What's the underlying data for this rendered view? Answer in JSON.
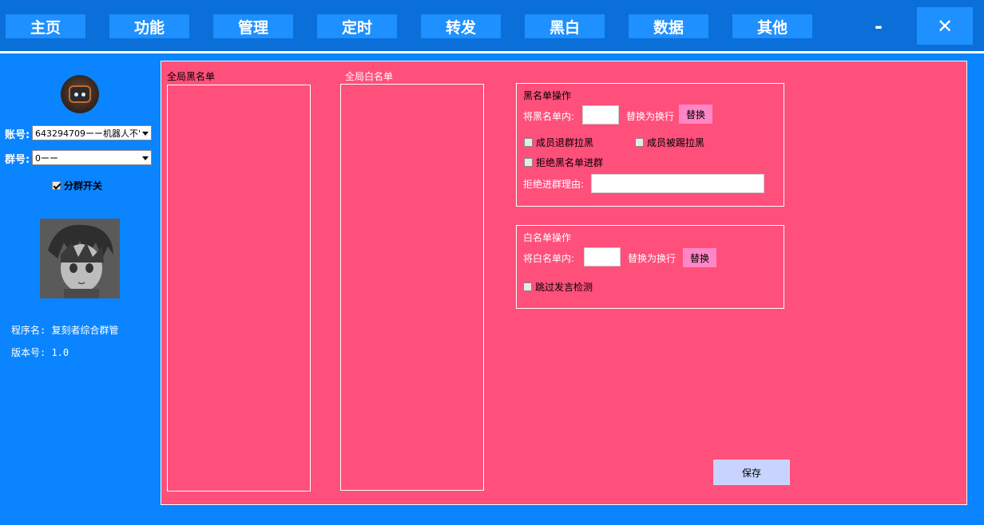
{
  "nav": {
    "home": "主页",
    "features": "功能",
    "manage": "管理",
    "timer": "定时",
    "forward": "转发",
    "blackwhite": "黑白",
    "data": "数据",
    "other": "其他"
  },
  "window": {
    "minimize": "-",
    "close": "✕"
  },
  "sidebar": {
    "account_label": "账号:",
    "account_value": "643294709ーー机器人不'",
    "group_label": "群号:",
    "group_value": "0ーー",
    "split_switch_label": "分群开关",
    "split_switch_checked": true,
    "program_name": "程序名: 复刻者综合群管",
    "version": "版本号: 1.0"
  },
  "main": {
    "blacklist_title": "全局黑名单",
    "whitelist_title": "全局白名单",
    "black_ops": {
      "title": "黑名单操作",
      "replace_prefix": "将黑名单内:",
      "replace_suffix": "替换为换行",
      "replace_button": "替换",
      "leave_blacklist": "成员退群拉黑",
      "kicked_blacklist": "成员被踢拉黑",
      "reject_join": "拒绝黑名单进群",
      "reject_reason_label": "拒绝进群理由:"
    },
    "white_ops": {
      "title": "白名单操作",
      "replace_prefix": "将白名单内:",
      "replace_suffix": "替换为换行",
      "replace_button": "替换",
      "skip_speech_check": "跳过发言检测"
    },
    "save_button": "保存"
  },
  "colors": {
    "background": "#0a84ff",
    "topbar": "#0a6fd8",
    "nav_button": "#1e90ff",
    "panel": "#ff4f7b",
    "replace_button": "#ff86c6",
    "save_button": "#c8d4ff"
  }
}
